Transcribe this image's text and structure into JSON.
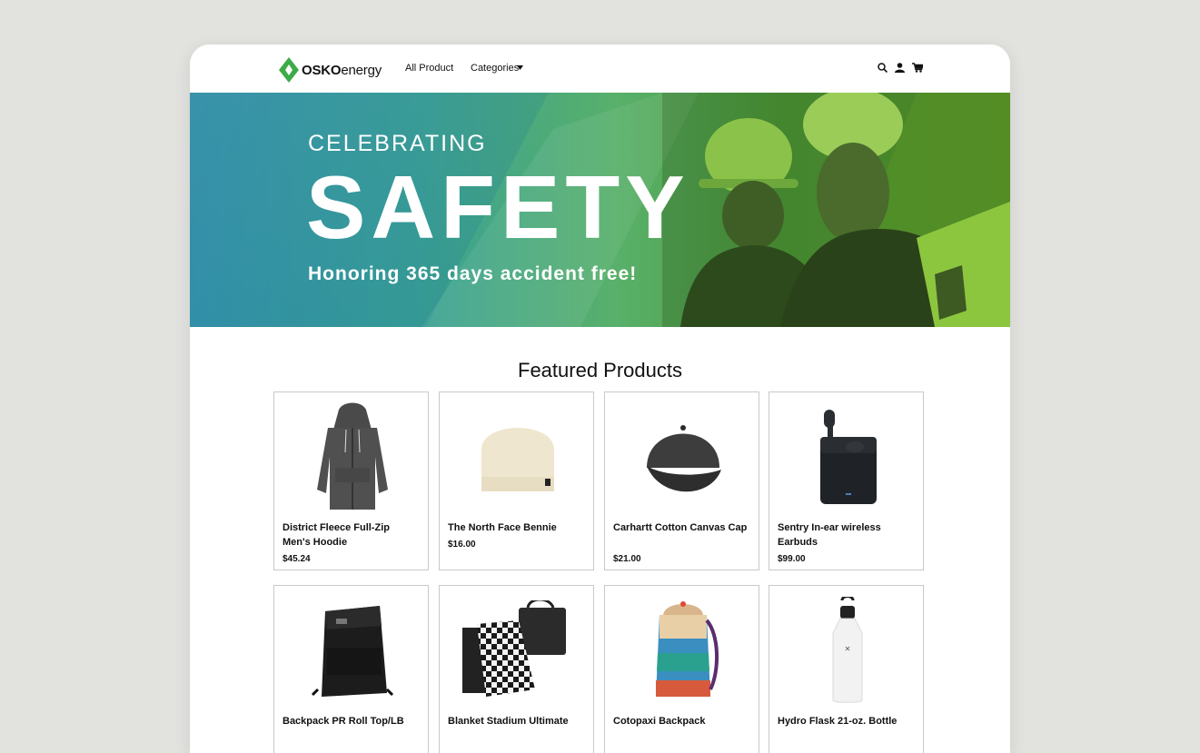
{
  "brand": {
    "name_bold": "OSKO",
    "name_light": "energy",
    "accent": "#3dab47"
  },
  "nav": {
    "all_product": "All Product",
    "categories": "Categories"
  },
  "icons": {
    "search": "search-icon",
    "account": "user-icon",
    "cart": "cart-icon"
  },
  "hero": {
    "kicker": "CELEBRATING",
    "title": "SAFETY",
    "subtitle": "Honoring 365 days accident free!"
  },
  "featured": {
    "title": "Featured Products",
    "products": [
      {
        "name": "District Fleece Full-Zip Men's Hoodie",
        "price": "$45.24"
      },
      {
        "name": "The North Face Bennie",
        "price": "$16.00"
      },
      {
        "name": "Carhartt Cotton Canvas Cap",
        "price": "$21.00"
      },
      {
        "name": "Sentry In-ear wireless Earbuds",
        "price": "$99.00"
      },
      {
        "name": "Backpack PR Roll Top/LB",
        "price": ""
      },
      {
        "name": "Blanket Stadium Ultimate",
        "price": ""
      },
      {
        "name": "Cotopaxi Backpack",
        "price": ""
      },
      {
        "name": "Hydro Flask 21-oz. Bottle",
        "price": ""
      }
    ]
  }
}
